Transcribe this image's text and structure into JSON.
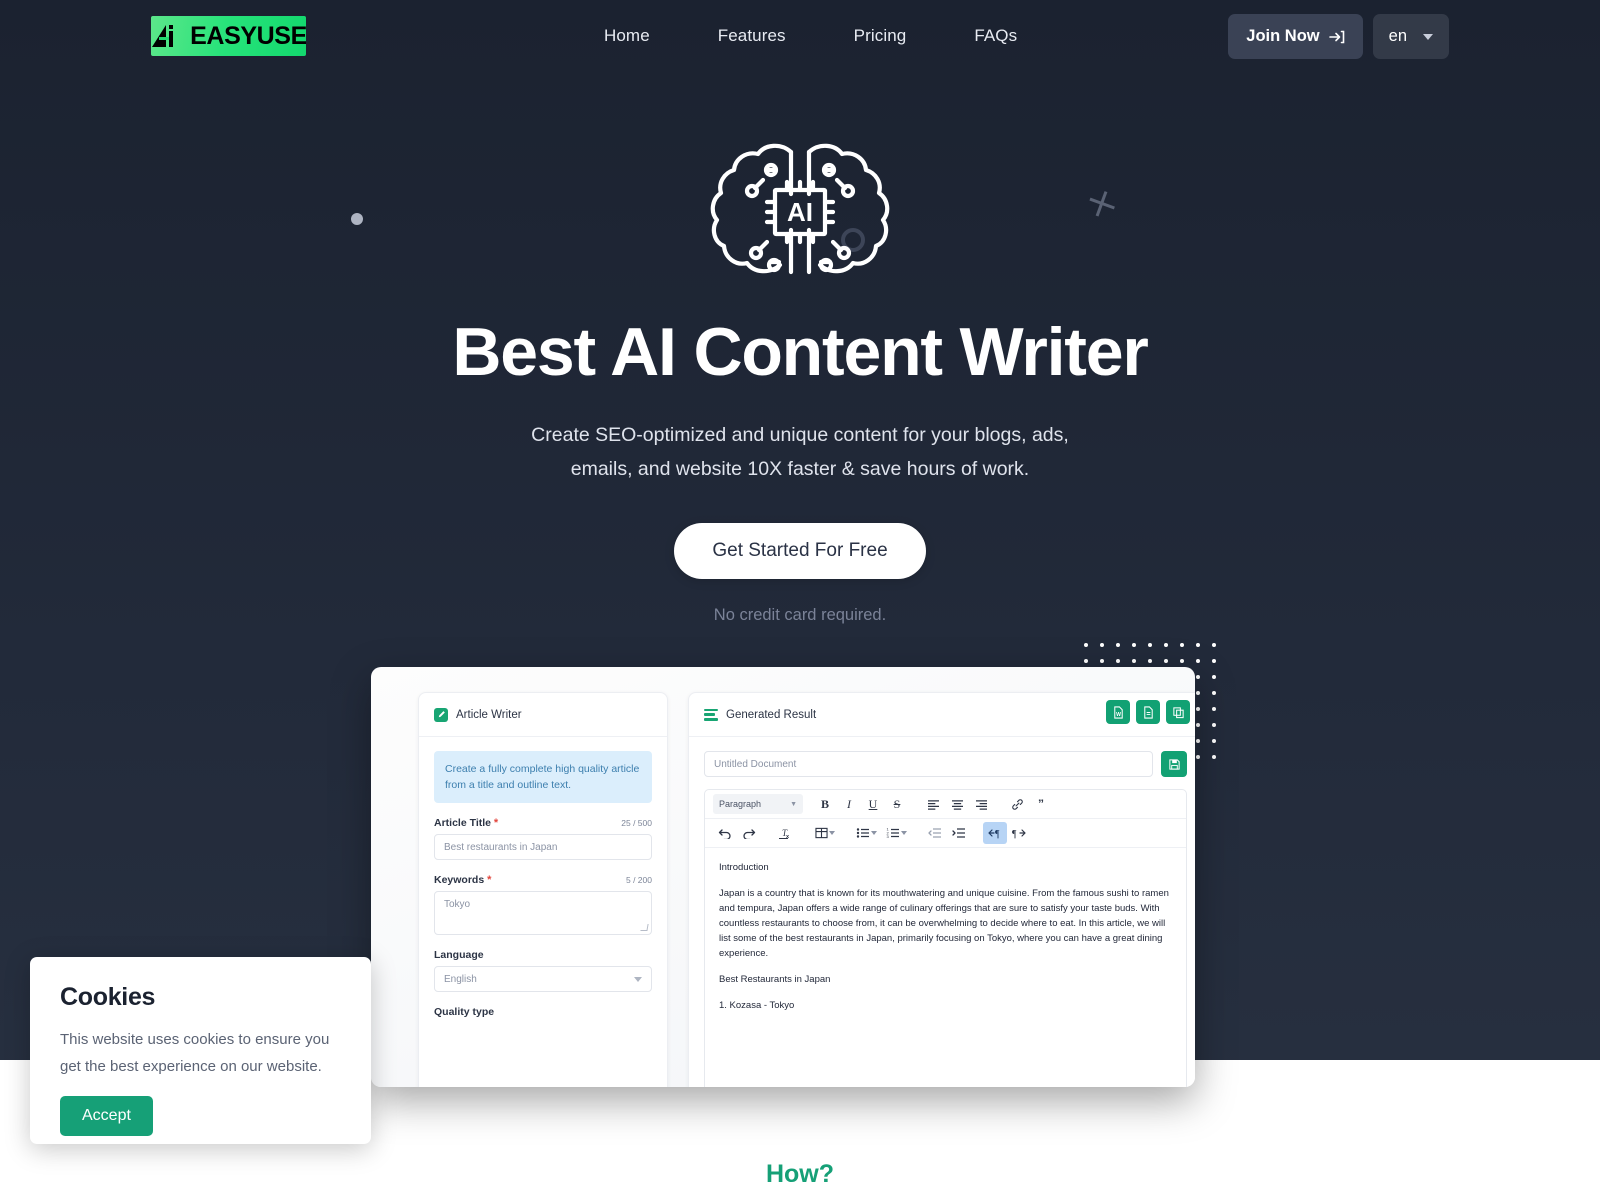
{
  "header": {
    "logo": {
      "mark": "AI",
      "word": "EASYUSE",
      "name": "ai-easyuse-logo"
    },
    "nav": [
      {
        "label": "Home"
      },
      {
        "label": "Features"
      },
      {
        "label": "Pricing"
      },
      {
        "label": "FAQs"
      }
    ],
    "join_label": "Join Now",
    "join_icon": "login-arrow-icon",
    "language": {
      "value": "en",
      "icon": "chevron-down-icon"
    }
  },
  "hero": {
    "icon": "ai-brain-chip-icon",
    "chip_label": "AI",
    "title": "Best AI Content Writer",
    "subtitle_line1": "Create SEO-optimized and unique content for your blogs, ads,",
    "subtitle_line2": "emails, and website 10X faster & save hours of work.",
    "cta_label": "Get Started For Free",
    "note": "No credit card required."
  },
  "app": {
    "left_panel": {
      "title": "Article Writer",
      "title_icon": "pencil-square-icon",
      "info": "Create a fully complete high quality article from a title and outline text.",
      "fields": [
        {
          "label": "Article Title",
          "required": "*",
          "counter": "25 / 500",
          "value": "Best restaurants in Japan",
          "type": "text"
        },
        {
          "label": "Keywords",
          "required": "*",
          "counter": "5 / 200",
          "value": "Tokyo",
          "type": "textarea"
        },
        {
          "label": "Language",
          "required": "",
          "counter": "",
          "value": "English",
          "type": "select"
        },
        {
          "label": "Quality type",
          "required": "",
          "counter": "",
          "value": "",
          "type": "label"
        }
      ]
    },
    "right_panel": {
      "title": "Generated Result",
      "title_icon": "lines-icon",
      "actions": [
        {
          "name": "export-word-icon",
          "glyph": "W"
        },
        {
          "name": "export-doc-icon",
          "glyph": "D"
        },
        {
          "name": "copy-icon",
          "glyph": "C"
        }
      ],
      "doc_name": "Untitled Document",
      "save_icon": "save-icon",
      "toolbar_row1": {
        "style_select": "Paragraph",
        "buttons": [
          {
            "name": "bold-button",
            "glyph": "B"
          },
          {
            "name": "italic-button",
            "glyph": "I"
          },
          {
            "name": "underline-button",
            "glyph": "U"
          },
          {
            "name": "strikethrough-button",
            "glyph": "S"
          },
          {
            "name": "align-left-button",
            "glyph": "align-left"
          },
          {
            "name": "align-center-button",
            "glyph": "align-center"
          },
          {
            "name": "align-right-button",
            "glyph": "align-right"
          },
          {
            "name": "link-button",
            "glyph": "link"
          },
          {
            "name": "blockquote-button",
            "glyph": "”"
          }
        ]
      },
      "toolbar_row2": {
        "buttons": [
          {
            "name": "undo-button",
            "glyph": "undo"
          },
          {
            "name": "redo-button",
            "glyph": "redo"
          },
          {
            "name": "clear-format-button",
            "glyph": "Tx"
          },
          {
            "name": "table-button",
            "glyph": "table"
          },
          {
            "name": "bullet-list-button",
            "glyph": "bullets"
          },
          {
            "name": "numbered-list-button",
            "glyph": "numbers"
          },
          {
            "name": "outdent-button",
            "glyph": "outdent"
          },
          {
            "name": "indent-button",
            "glyph": "indent"
          },
          {
            "name": "rtl-button",
            "glyph": "rtl"
          },
          {
            "name": "ltr-button",
            "glyph": "ltr"
          }
        ]
      },
      "document": {
        "heading1": "Introduction",
        "paragraph1": "Japan is a country that is known for its mouthwatering and unique cuisine. From the famous sushi to ramen and tempura, Japan offers a wide range of culinary offerings that are sure to satisfy your taste buds. With countless restaurants to choose from, it can be overwhelming to decide where to eat. In this article, we will list some of the best restaurants in Japan, primarily focusing on Tokyo, where you can have a great dining experience.",
        "heading2": "Best Restaurants in Japan",
        "item1": "1. Kozasa - Tokyo"
      }
    }
  },
  "cookies": {
    "title": "Cookies",
    "body": "This website uses cookies to ensure you get the best experience on our website.",
    "accept_label": "Accept"
  },
  "bottom": {
    "how_label": "How?"
  },
  "colors": {
    "brand_green": "#16a077",
    "logo_green": "#27e37a",
    "bg_dark": "#1d2432",
    "cta_white": "#ffffff"
  }
}
